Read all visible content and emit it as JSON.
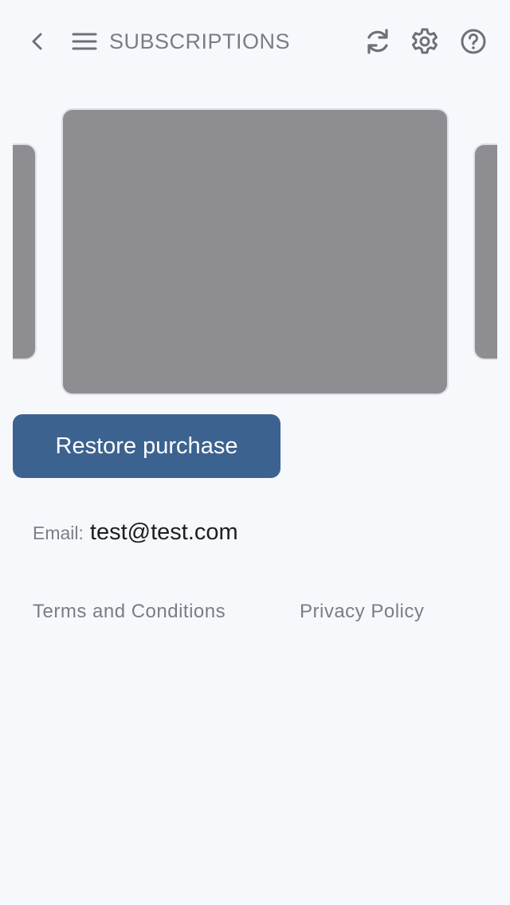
{
  "header": {
    "title": "SUBSCRIPTIONS",
    "icons": {
      "back": "chevron-left-icon",
      "menu": "hamburger-menu-icon",
      "refresh": "refresh-icon",
      "settings": "gear-icon",
      "help": "help-circle-icon"
    }
  },
  "main": {
    "restore_button_label": "Restore purchase",
    "email_label": "Email:",
    "email_value": "test@test.com",
    "links": {
      "terms": "Terms and Conditions",
      "privacy": "Privacy Policy"
    }
  },
  "colors": {
    "background": "#f7f8fc",
    "card_placeholder": "#8e8d92",
    "primary_button": "#3c6290",
    "muted_text": "#7a7d85",
    "value_text": "#1d1e22"
  }
}
